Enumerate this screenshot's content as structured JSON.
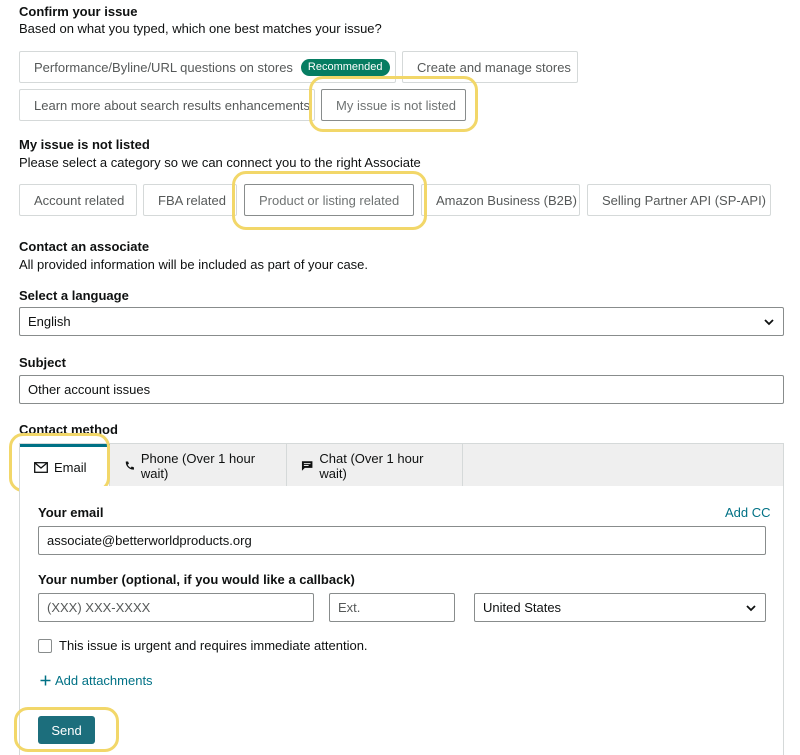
{
  "confirm": {
    "title": "Confirm your issue",
    "subtitle": "Based on what you typed, which one best matches your issue?",
    "options": [
      {
        "label": "Performance/Byline/URL questions on stores",
        "badge": "Recommended"
      },
      {
        "label": "Create and manage stores"
      },
      {
        "label": "Learn more about search results enhancements"
      },
      {
        "label": "My issue is not listed",
        "selected": true
      }
    ]
  },
  "not_listed": {
    "title": "My issue is not listed",
    "subtitle": "Please select a category so we can connect you to the right Associate",
    "categories": [
      {
        "label": "Account related"
      },
      {
        "label": "FBA related"
      },
      {
        "label": "Product or listing related",
        "selected": true
      },
      {
        "label": "Amazon Business (B2B)"
      },
      {
        "label": "Selling Partner API (SP-API)"
      }
    ]
  },
  "contact": {
    "title": "Contact an associate",
    "subtitle": "All provided information will be included as part of your case."
  },
  "language": {
    "label": "Select a language",
    "value": "English"
  },
  "subject": {
    "label": "Subject",
    "value": "Other account issues"
  },
  "method": {
    "label": "Contact method",
    "tabs": [
      {
        "label": "Email",
        "icon": "envelope-icon",
        "active": true
      },
      {
        "label": "Phone (Over 1 hour wait)",
        "icon": "phone-icon"
      },
      {
        "label": "Chat (Over 1 hour wait)",
        "icon": "chat-icon"
      }
    ]
  },
  "email_form": {
    "email_label": "Your email",
    "add_cc": "Add CC",
    "email_value": "associate@betterworldproducts.org",
    "number_label": "Your number (optional, if you would like a callback)",
    "number_placeholder": "(XXX) XXX-XXXX",
    "ext_placeholder": "Ext.",
    "country": "United States",
    "urgent_label": "This issue is urgent and requires immediate attention.",
    "add_attachments": "Add attachments",
    "send": "Send"
  },
  "colors": {
    "highlight": "#f2d769",
    "badge": "#067d62",
    "accent": "#007185",
    "send_button": "#1c6e7c"
  }
}
